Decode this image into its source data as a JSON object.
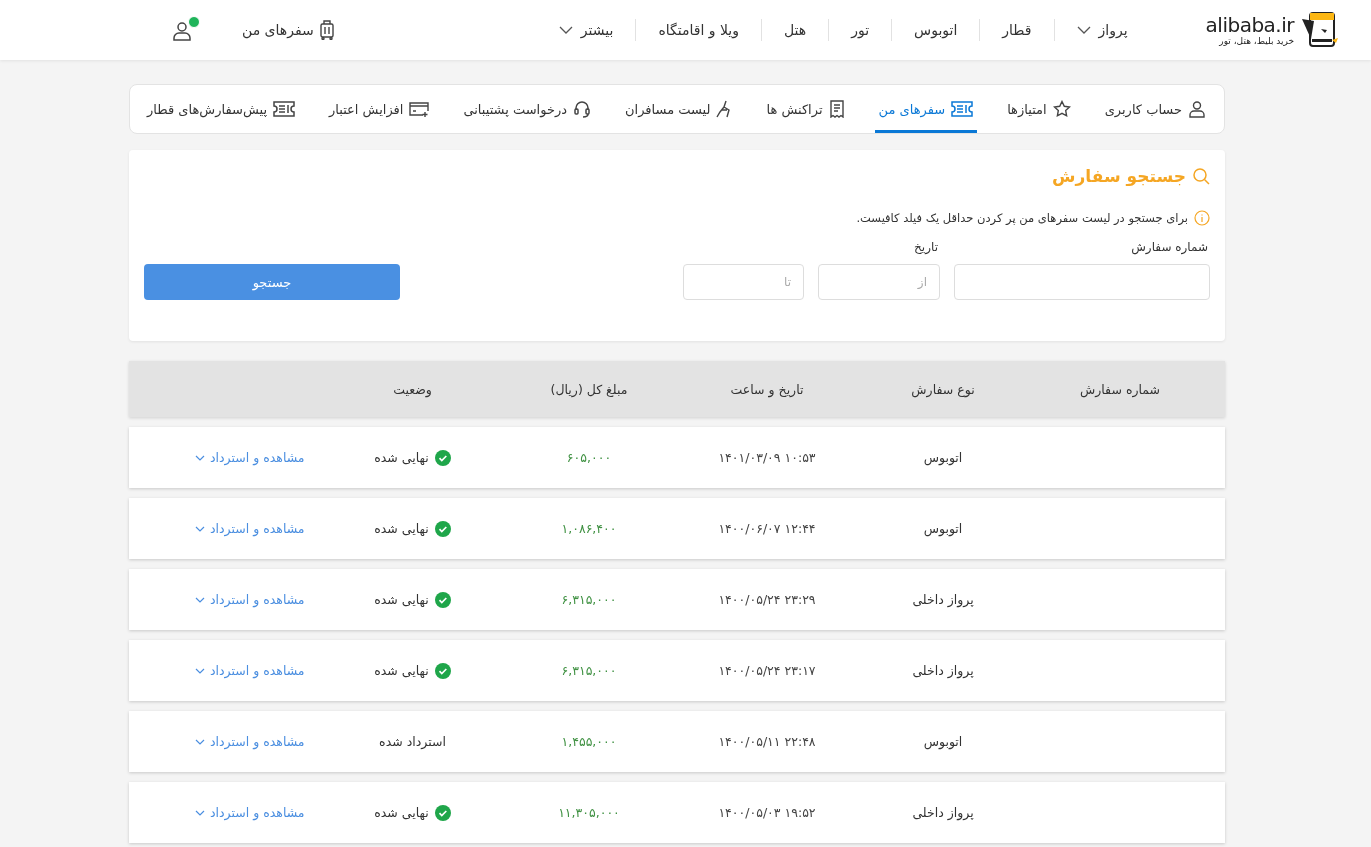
{
  "header": {
    "logo": {
      "wordmark": "alibaba.ir",
      "tagline": "خرید بلیط، هتل، تور"
    },
    "nav": [
      {
        "label": "پرواز",
        "has_menu": true
      },
      {
        "label": "قطار",
        "has_menu": false
      },
      {
        "label": "اتوبوس",
        "has_menu": false
      },
      {
        "label": "تور",
        "has_menu": false
      },
      {
        "label": "هتل",
        "has_menu": false
      },
      {
        "label": "ویلا و اقامتگاه",
        "has_menu": false
      },
      {
        "label": "بیشتر",
        "has_menu": true
      }
    ],
    "my_trips": "سفرهای من",
    "user": {
      "verified": true
    }
  },
  "tabs": [
    {
      "label": "حساب کاربری",
      "selected": false
    },
    {
      "label": "امتیازها",
      "selected": false
    },
    {
      "label": "سفرهای من",
      "selected": true
    },
    {
      "label": "تراکنش ها",
      "selected": false
    },
    {
      "label": "لیست مسافران",
      "selected": false
    },
    {
      "label": "درخواست پشتیبانی",
      "selected": false
    },
    {
      "label": "افزایش اعتبار",
      "selected": false
    },
    {
      "label": "پیش‌سفارش‌های قطار",
      "selected": false
    }
  ],
  "search": {
    "title": "جستجو سفارش",
    "hint": "برای جستجو در لیست سفرهای من پر کردن حداقل یک فیلد کافیست.",
    "order_number": {
      "label": "شماره سفارش"
    },
    "date": {
      "label": "تاریخ",
      "from_placeholder": "از",
      "to_placeholder": "تا"
    },
    "button": "جستجو"
  },
  "table": {
    "columns": [
      "شماره سفارش",
      "نوع سفارش",
      "تاریخ و ساعت",
      "مبلغ کل (ریال)",
      "وضعیت"
    ],
    "rows": [
      {
        "type": "اتوبوس",
        "datetime": "۱۴۰۱/۰۳/۰۹ ۱۰:۵۳",
        "amount": "۶۰۵,۰۰۰",
        "status": {
          "kind": "final",
          "label": "نهایی شده"
        },
        "action": "مشاهده و استرداد"
      },
      {
        "type": "اتوبوس",
        "datetime": "۱۴۰۰/۰۶/۰۷ ۱۲:۴۴",
        "amount": "۱,۰۸۶,۴۰۰",
        "status": {
          "kind": "final",
          "label": "نهایی شده"
        },
        "action": "مشاهده و استرداد"
      },
      {
        "type": "پرواز داخلی",
        "datetime": "۱۴۰۰/۰۵/۲۴ ۲۳:۲۹",
        "amount": "۶,۳۱۵,۰۰۰",
        "status": {
          "kind": "final",
          "label": "نهایی شده"
        },
        "action": "مشاهده و استرداد"
      },
      {
        "type": "پرواز داخلی",
        "datetime": "۱۴۰۰/۰۵/۲۴ ۲۳:۱۷",
        "amount": "۶,۳۱۵,۰۰۰",
        "status": {
          "kind": "final",
          "label": "نهایی شده"
        },
        "action": "مشاهده و استرداد"
      },
      {
        "type": "اتوبوس",
        "datetime": "۱۴۰۰/۰۵/۱۱ ۲۲:۴۸",
        "amount": "۱,۴۵۵,۰۰۰",
        "status": {
          "kind": "refunded",
          "label": "استرداد شده"
        },
        "action": "مشاهده و استرداد"
      },
      {
        "type": "پرواز داخلی",
        "datetime": "۱۴۰۰/۰۵/۰۳ ۱۹:۵۲",
        "amount": "۱۱,۳۰۵,۰۰۰",
        "status": {
          "kind": "final",
          "label": "نهایی شده"
        },
        "action": "مشاهده و استرداد"
      }
    ]
  }
}
